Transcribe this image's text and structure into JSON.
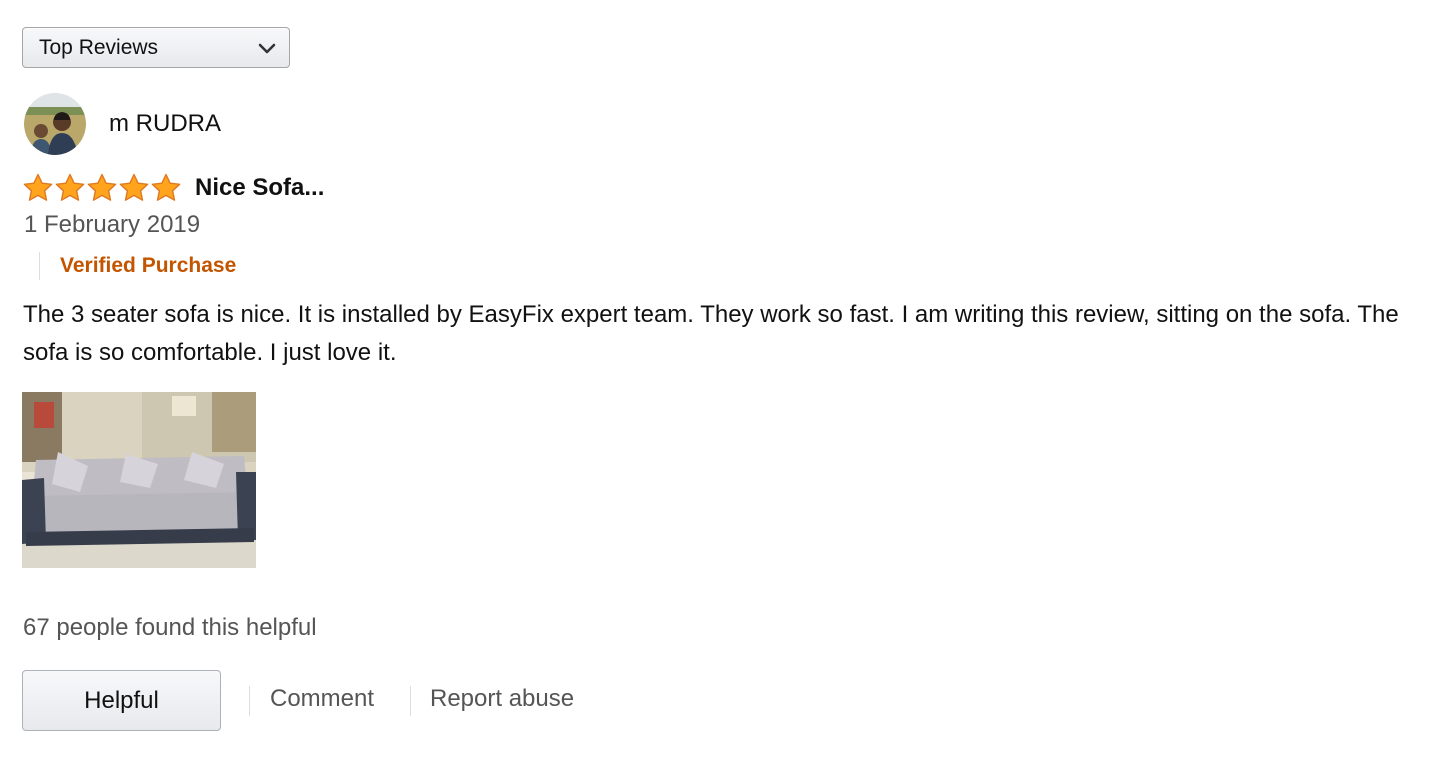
{
  "sort": {
    "selected": "Top Reviews"
  },
  "reviewer": {
    "name": "m RUDRA"
  },
  "review": {
    "rating": 5,
    "rating_max": 5,
    "title": "Nice Sofa...",
    "date": "1 February 2019",
    "verified_label": "Verified Purchase",
    "body": "The 3 seater sofa is nice. It is installed by EasyFix expert team. They work so fast. I am writing this review, sitting on the sofa. The sofa is so comfortable. I just love it.",
    "helpful_count_text": "67 people found this helpful"
  },
  "actions": {
    "helpful_label": "Helpful",
    "comment_label": "Comment",
    "report_label": "Report abuse"
  },
  "colors": {
    "star": "#ffa41c",
    "star_outline": "#de7921",
    "verified": "#c45500",
    "muted_text": "#555555"
  },
  "icons": {
    "dropdown": "chevron-down-icon",
    "star": "star-icon"
  }
}
